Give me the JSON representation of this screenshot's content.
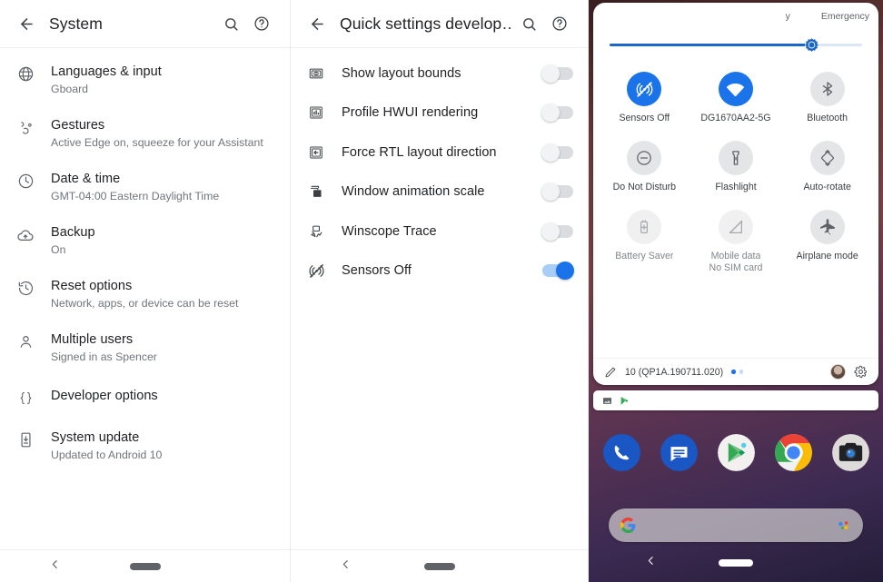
{
  "left_panel": {
    "appbar": {
      "back_icon": "arrow-back-icon",
      "title": "System",
      "search_icon": "search-icon",
      "help_icon": "help-icon"
    },
    "items": [
      {
        "icon": "globe-icon",
        "title": "Languages & input",
        "subtitle": "Gboard"
      },
      {
        "icon": "gesture-icon",
        "title": "Gestures",
        "subtitle": "Active Edge on, squeeze for your Assistant"
      },
      {
        "icon": "clock-icon",
        "title": "Date & time",
        "subtitle": "GMT-04:00 Eastern Daylight Time"
      },
      {
        "icon": "cloud-backup-icon",
        "title": "Backup",
        "subtitle": "On"
      },
      {
        "icon": "history-icon",
        "title": "Reset options",
        "subtitle": "Network, apps, or device can be reset"
      },
      {
        "icon": "person-icon",
        "title": "Multiple users",
        "subtitle": "Signed in as Spencer"
      },
      {
        "icon": "braces-icon",
        "title": "Developer options",
        "subtitle": ""
      },
      {
        "icon": "system-update-icon",
        "title": "System update",
        "subtitle": "Updated to Android 10"
      }
    ],
    "navbar": {
      "back_icon": "nav-back-icon",
      "home_pill": "home-pill"
    }
  },
  "mid_panel": {
    "appbar": {
      "back_icon": "arrow-back-icon",
      "title": "Quick settings develop…",
      "search_icon": "search-icon",
      "help_icon": "help-icon"
    },
    "toggles": [
      {
        "icon": "layout-bounds-icon",
        "label": "Show layout bounds",
        "state": "off"
      },
      {
        "icon": "hwui-profile-icon",
        "label": "Profile HWUI rendering",
        "state": "off"
      },
      {
        "icon": "rtl-layout-icon",
        "label": "Force RTL layout direction",
        "state": "off"
      },
      {
        "icon": "window-animation-icon",
        "label": "Window animation scale",
        "state": "off"
      },
      {
        "icon": "winscope-trace-icon",
        "label": "Winscope Trace",
        "state": "off"
      },
      {
        "icon": "sensors-off-icon",
        "label": "Sensors Off",
        "state": "on"
      }
    ],
    "navbar": {
      "back_icon": "nav-back-icon",
      "home_pill": "home-pill"
    }
  },
  "right_panel": {
    "status_bar": {
      "left_text": "y",
      "right_text": "Emergency"
    },
    "brightness": {
      "icon": "brightness-icon",
      "percent": 80
    },
    "tiles": [
      {
        "icon": "sensors-off-icon",
        "label": "Sensors Off",
        "sublabel": "",
        "state": "on"
      },
      {
        "icon": "wifi-icon",
        "label": "DG1670AA2-5G",
        "sublabel": "",
        "state": "on"
      },
      {
        "icon": "bluetooth-icon",
        "label": "Bluetooth",
        "sublabel": "",
        "state": "off"
      },
      {
        "icon": "do-not-disturb-icon",
        "label": "Do Not Disturb",
        "sublabel": "",
        "state": "off"
      },
      {
        "icon": "flashlight-icon",
        "label": "Flashlight",
        "sublabel": "",
        "state": "off"
      },
      {
        "icon": "auto-rotate-icon",
        "label": "Auto-rotate",
        "sublabel": "",
        "state": "off"
      },
      {
        "icon": "battery-saver-icon",
        "label": "Battery Saver",
        "sublabel": "",
        "state": "disabled"
      },
      {
        "icon": "mobile-data-icon",
        "label": "Mobile data",
        "sublabel": "No SIM card",
        "state": "disabled"
      },
      {
        "icon": "airplane-mode-icon",
        "label": "Airplane mode",
        "sublabel": "",
        "state": "off"
      }
    ],
    "footer": {
      "edit_icon": "pencil-icon",
      "build": "10 (QP1A.190711.020)",
      "page_dots": 2,
      "active_dot": 1,
      "avatar": "user-avatar",
      "settings_icon": "gear-icon"
    },
    "notification_strip": {
      "icons": [
        "image-icon",
        "play-store-icon"
      ]
    },
    "dock": [
      {
        "icon": "phone-app-icon",
        "label": "Phone"
      },
      {
        "icon": "messages-app-icon",
        "label": "Messages"
      },
      {
        "icon": "play-store-app-icon",
        "label": "Play Store"
      },
      {
        "icon": "chrome-app-icon",
        "label": "Chrome"
      },
      {
        "icon": "camera-app-icon",
        "label": "Camera"
      }
    ],
    "search_widget": {
      "google_icon": "google-g-icon",
      "assistant_icon": "assistant-icon",
      "placeholder": ""
    },
    "navbar": {
      "back_icon": "nav-back-icon",
      "home_pill": "home-pill"
    }
  },
  "colors": {
    "accent_blue": "#1a73e8",
    "toggle_off": "#dadce0",
    "tile_off": "#e4e5e6",
    "text_primary": "#202124",
    "text_secondary": "#70757a"
  }
}
